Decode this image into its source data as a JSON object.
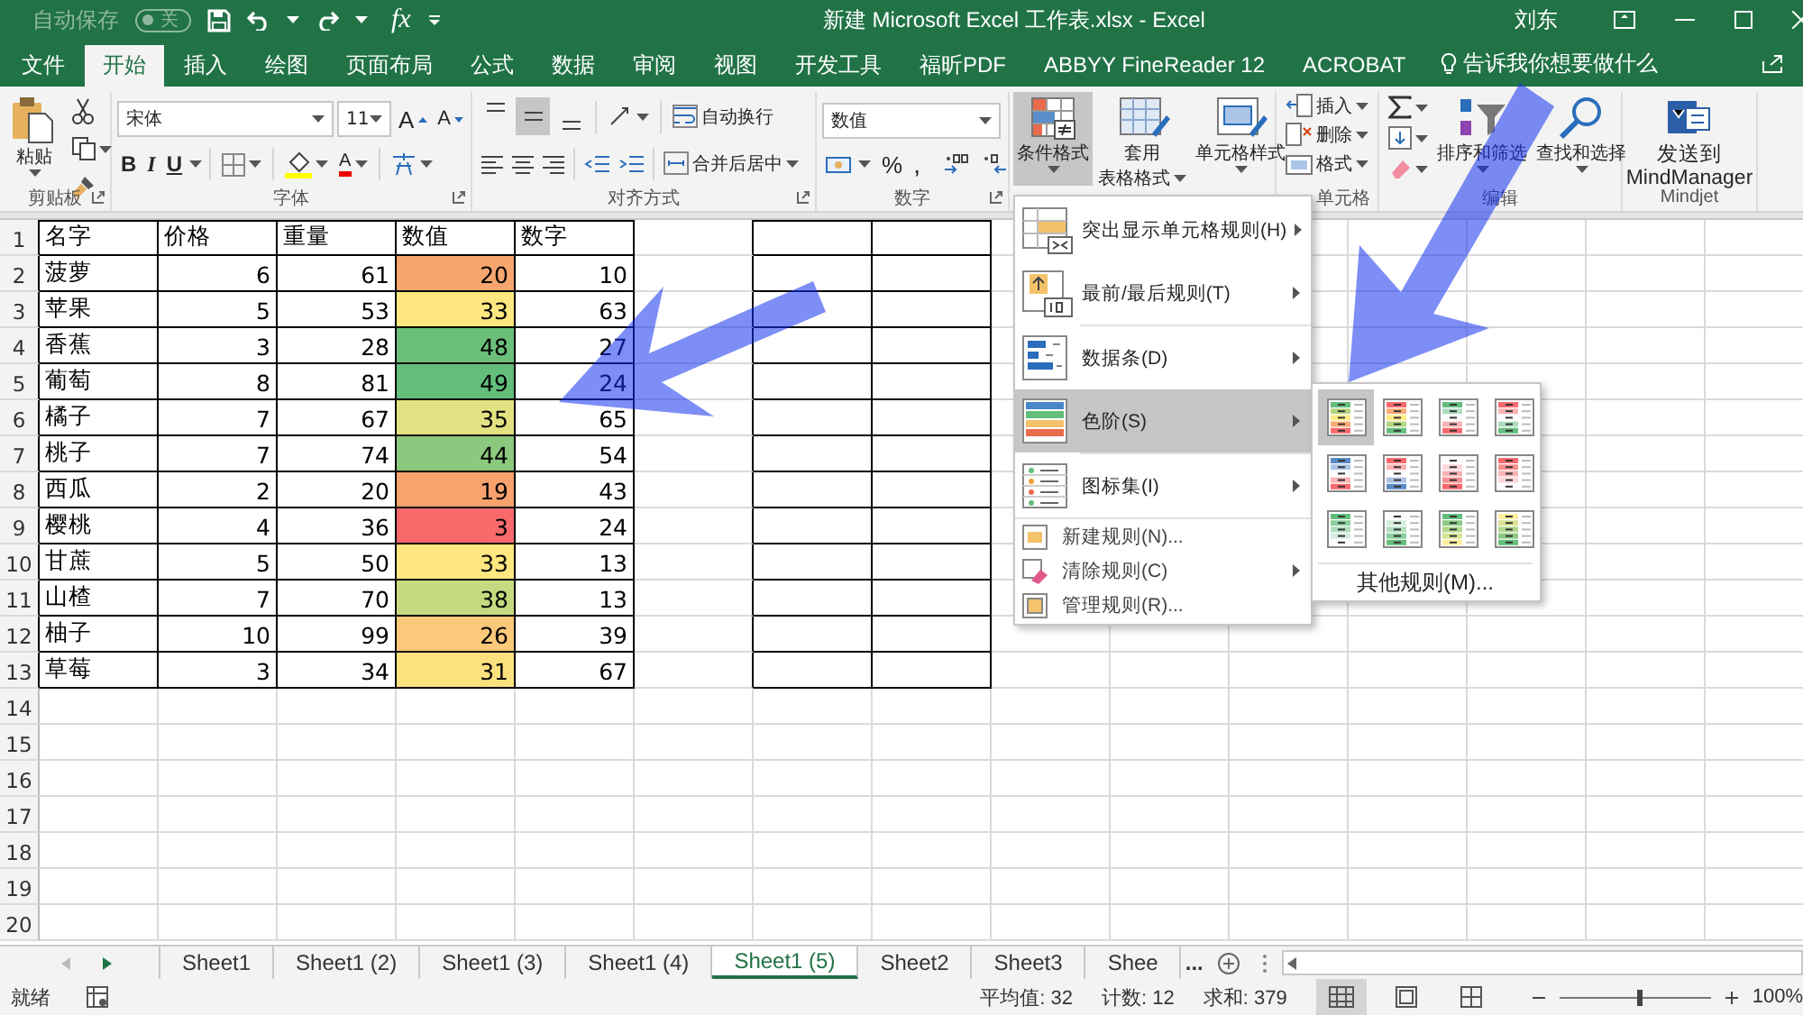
{
  "title_bar": {
    "autosave_label": "自动保存",
    "autosave_on": false,
    "autosave_state": "关",
    "formula_symbol": "fx",
    "title": "新建 Microsoft Excel 工作表.xlsx  -  Excel",
    "user": "刘东"
  },
  "tabs": [
    {
      "label": "文件",
      "selected": false
    },
    {
      "label": "开始",
      "selected": true
    },
    {
      "label": "插入",
      "selected": false
    },
    {
      "label": "绘图",
      "selected": false
    },
    {
      "label": "页面布局",
      "selected": false
    },
    {
      "label": "公式",
      "selected": false
    },
    {
      "label": "数据",
      "selected": false
    },
    {
      "label": "审阅",
      "selected": false
    },
    {
      "label": "视图",
      "selected": false
    },
    {
      "label": "开发工具",
      "selected": false
    },
    {
      "label": "福昕PDF",
      "selected": false
    },
    {
      "label": "ABBYY FineReader 12",
      "selected": false
    },
    {
      "label": "ACROBAT",
      "selected": false
    }
  ],
  "tell_me": "告诉我你想要做什么",
  "ribbon": {
    "clipboard": {
      "paste": "粘贴",
      "label": "剪贴板"
    },
    "font": {
      "name": "宋体",
      "size": "11",
      "grow": "A",
      "shrink": "A",
      "bold": "B",
      "italic": "I",
      "underline": "U",
      "color_button": "A",
      "label": "字体"
    },
    "alignment": {
      "vertical": [
        {
          "selected": false
        },
        {
          "selected": true
        },
        {
          "selected": false
        }
      ],
      "wrap": "自动换行",
      "merge": "合并后居中",
      "label": "对齐方式"
    },
    "number": {
      "format": "数值",
      "percent": "%",
      "comma": ",",
      "label": "数字"
    },
    "styles": {
      "buttons": [
        {
          "lines": [
            "条件格式"
          ],
          "pressed": true
        },
        {
          "lines": [
            "套用",
            "表格格式"
          ],
          "pressed": false
        },
        {
          "lines": [
            "单元格样式"
          ],
          "pressed": false
        }
      ]
    },
    "cells": {
      "buttons": [
        "插入",
        "删除",
        "格式"
      ],
      "label": "单元格"
    },
    "editing": {
      "buttons": [
        {
          "lines": [
            "排序和筛选"
          ]
        },
        {
          "lines": [
            "查找和选择"
          ]
        }
      ],
      "label": "编辑"
    },
    "mindjet": {
      "lines": [
        "发送到",
        "MindManager"
      ],
      "label": "Mindjet"
    }
  },
  "sheet": {
    "row_numbers": [
      "1",
      "2",
      "3",
      "4",
      "5",
      "6",
      "7",
      "8",
      "9",
      "10",
      "11",
      "12",
      "13",
      "14",
      "15",
      "16",
      "17",
      "18",
      "19",
      "20"
    ],
    "rows": [
      {
        "kind": "header",
        "cells": [
          "名字",
          "价格",
          "重量",
          "数值",
          "数字"
        ]
      },
      {
        "kind": "data",
        "cells": [
          "菠萝",
          "6",
          "61",
          "20",
          "10"
        ],
        "color": "#f8a66f"
      },
      {
        "kind": "data",
        "cells": [
          "苹果",
          "5",
          "53",
          "33",
          "63"
        ],
        "color": "#fee680"
      },
      {
        "kind": "data",
        "cells": [
          "香蕉",
          "3",
          "28",
          "48",
          "27"
        ],
        "color": "#6cbf7a"
      },
      {
        "kind": "data",
        "cells": [
          "葡萄",
          "8",
          "81",
          "49",
          "24"
        ],
        "color": "#63be7b"
      },
      {
        "kind": "data",
        "cells": [
          "橘子",
          "7",
          "67",
          "35",
          "65"
        ],
        "color": "#e3e282"
      },
      {
        "kind": "data",
        "cells": [
          "桃子",
          "7",
          "74",
          "44",
          "54"
        ],
        "color": "#8cc97e"
      },
      {
        "kind": "data",
        "cells": [
          "西瓜",
          "2",
          "20",
          "19",
          "43"
        ],
        "color": "#f8a26e"
      },
      {
        "kind": "data",
        "cells": [
          "樱桃",
          "4",
          "36",
          "3",
          "24"
        ],
        "color": "#f8696b"
      },
      {
        "kind": "data",
        "cells": [
          "甘蔗",
          "5",
          "50",
          "33",
          "13"
        ],
        "color": "#fee680"
      },
      {
        "kind": "data",
        "cells": [
          "山楂",
          "7",
          "70",
          "38",
          "13"
        ],
        "color": "#c5da80"
      },
      {
        "kind": "data",
        "cells": [
          "柚子",
          "10",
          "99",
          "26",
          "39"
        ],
        "color": "#fcc87a"
      },
      {
        "kind": "data",
        "cells": [
          "草莓",
          "3",
          "34",
          "31",
          "67"
        ],
        "color": "#fee17f"
      }
    ]
  },
  "conditional_menu": {
    "items": [
      {
        "kind": "large",
        "label": "突出显示单元格规则(H)",
        "submenu": true,
        "selected": false
      },
      {
        "kind": "large",
        "label": "最前/最后规则(T)",
        "submenu": true,
        "selected": false
      },
      {
        "kind": "large",
        "label": "数据条(D)",
        "submenu": true,
        "selected": false
      },
      {
        "kind": "large",
        "label": "色阶(S)",
        "submenu": true,
        "selected": true
      },
      {
        "kind": "large",
        "label": "图标集(I)",
        "submenu": true,
        "selected": false
      },
      {
        "kind": "small",
        "label": "新建规则(N)...",
        "submenu": false,
        "selected": false
      },
      {
        "kind": "small",
        "label": "清除规则(C)",
        "submenu": true,
        "selected": false
      },
      {
        "kind": "small",
        "label": "管理规则(R)...",
        "submenu": false,
        "selected": false
      }
    ]
  },
  "color_scale_menu": {
    "options": [
      {
        "stops": [
          {
            "color": "#63be7b"
          },
          {
            "color": "#ffeb84"
          },
          {
            "color": "#f8696b"
          }
        ],
        "selected": true
      },
      {
        "stops": [
          {
            "color": "#f8696b"
          },
          {
            "color": "#ffeb84"
          },
          {
            "color": "#63be7b"
          }
        ],
        "selected": false
      },
      {
        "stops": [
          {
            "color": "#63be7b"
          },
          {
            "color": "#fcfcff"
          },
          {
            "color": "#f8696b"
          }
        ],
        "selected": false
      },
      {
        "stops": [
          {
            "color": "#f8696b"
          },
          {
            "color": "#fcfcff"
          },
          {
            "color": "#63be7b"
          }
        ],
        "selected": false
      },
      {
        "stops": [
          {
            "color": "#5a8ac6"
          },
          {
            "color": "#fcfcff"
          },
          {
            "color": "#f8696b"
          }
        ],
        "selected": false
      },
      {
        "stops": [
          {
            "color": "#f8696b"
          },
          {
            "color": "#fcfcff"
          },
          {
            "color": "#5a8ac6"
          }
        ],
        "selected": false
      },
      {
        "stops": [
          {
            "color": "#fcfcff"
          },
          {
            "color": "#f8696b"
          }
        ],
        "selected": false
      },
      {
        "stops": [
          {
            "color": "#f8696b"
          },
          {
            "color": "#fcfcff"
          }
        ],
        "selected": false
      },
      {
        "stops": [
          {
            "color": "#63be7b"
          },
          {
            "color": "#fcfcff"
          }
        ],
        "selected": false
      },
      {
        "stops": [
          {
            "color": "#fcfcff"
          },
          {
            "color": "#63be7b"
          }
        ],
        "selected": false
      },
      {
        "stops": [
          {
            "color": "#63be7b"
          },
          {
            "color": "#ffef9c"
          }
        ],
        "selected": false
      },
      {
        "stops": [
          {
            "color": "#ffef9c"
          },
          {
            "color": "#63be7b"
          }
        ],
        "selected": false
      }
    ],
    "more": "其他规则(M)..."
  },
  "sheet_tabs": {
    "tabs": [
      {
        "label": "Sheet1",
        "selected": false
      },
      {
        "label": "Sheet1 (2)",
        "selected": false
      },
      {
        "label": "Sheet1 (3)",
        "selected": false
      },
      {
        "label": "Sheet1 (4)",
        "selected": false
      },
      {
        "label": "Sheet1 (5)",
        "selected": true
      },
      {
        "label": "Sheet2",
        "selected": false
      },
      {
        "label": "Sheet3",
        "selected": false
      },
      {
        "label": "Shee",
        "selected": false
      }
    ],
    "more": "..."
  },
  "status_bar": {
    "ready": "就绪",
    "stats": [
      "平均值: 32",
      "计数: 12",
      "求和: 379"
    ],
    "views": [
      {
        "selected": true
      },
      {
        "selected": false
      },
      {
        "selected": false
      }
    ],
    "zoom": {
      "level": 0.52,
      "reading": "100%"
    }
  }
}
